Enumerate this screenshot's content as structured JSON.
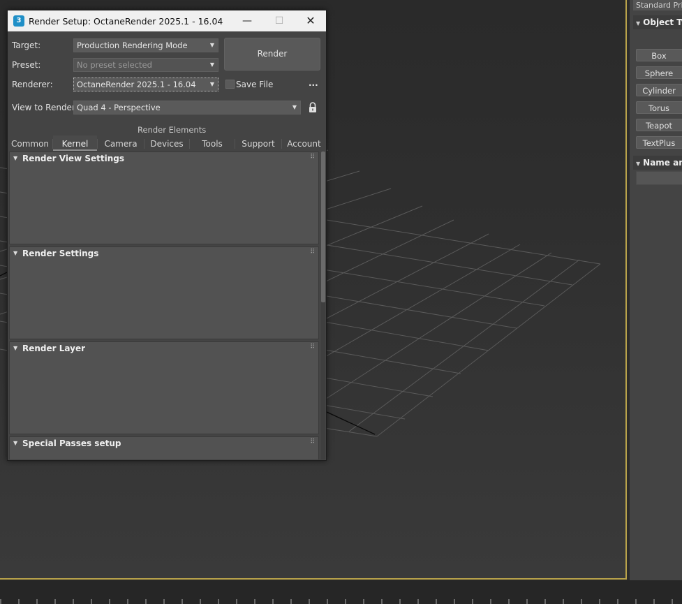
{
  "dialog": {
    "title": "Render Setup: OctaneRender 2025.1 - 16.04",
    "icon_label": "3",
    "window_buttons": {
      "minimize": "—",
      "maximize": "☐",
      "close": "✕"
    },
    "target": {
      "label": "Target:",
      "value": "Production Rendering Mode"
    },
    "preset": {
      "label": "Preset:",
      "value": "No preset selected"
    },
    "renderer": {
      "label": "Renderer:",
      "value": "OctaneRender 2025.1 - 16.04"
    },
    "save_file": {
      "label": "Save File",
      "checked": false
    },
    "more_label": "...",
    "view_to_render": {
      "label": "View to Render:",
      "value": "Quad 4 - Perspective"
    },
    "render_button": "Render",
    "render_elements_label": "Render Elements",
    "tabs": [
      {
        "label": "Common"
      },
      {
        "label": "Kernel",
        "active": true
      },
      {
        "label": "Camera"
      },
      {
        "label": "Devices"
      },
      {
        "label": "Tools"
      },
      {
        "label": "Support"
      },
      {
        "label": "Account"
      }
    ],
    "rollouts": [
      {
        "title": "Render View Settings"
      },
      {
        "title": "Render Settings"
      },
      {
        "title": "Render Layer"
      },
      {
        "title": "Special Passes setup"
      }
    ]
  },
  "command_panel": {
    "dropdown": "Standard Primitives",
    "object_type_title": "Object Type",
    "primitives": [
      "Box",
      "Sphere",
      "Cylinder",
      "Torus",
      "Teapot",
      "TextPlus"
    ],
    "name_color_title": "Name and Color"
  },
  "colors": {
    "viewport_border": "#b8a24a",
    "dialog_bg": "#444444",
    "titlebar_bg": "#f0f0f0"
  }
}
